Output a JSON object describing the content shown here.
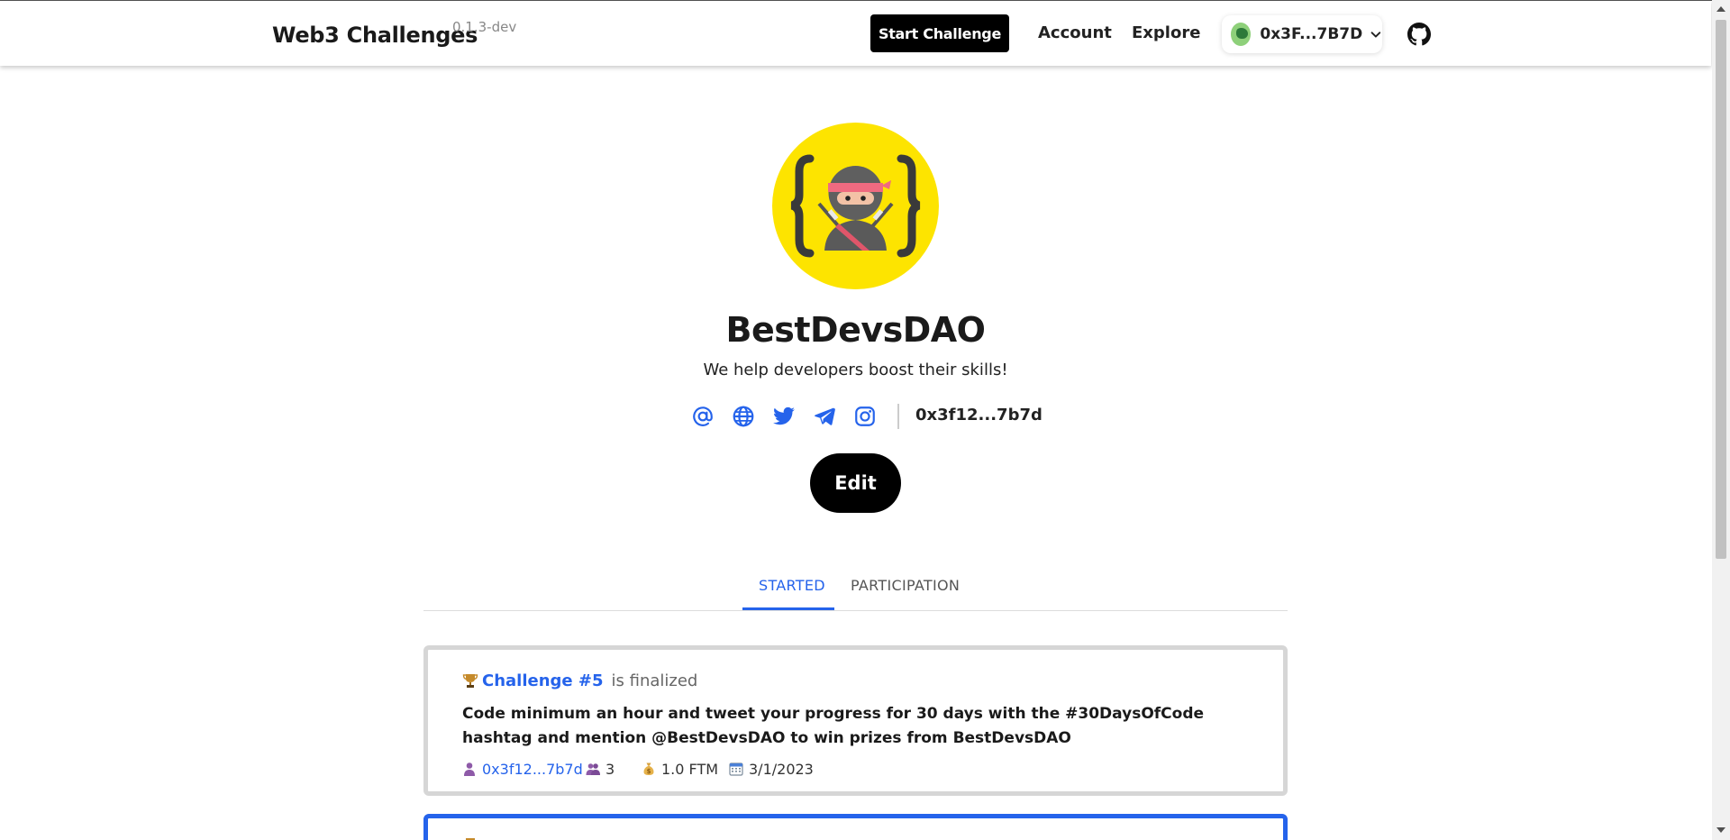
{
  "header": {
    "brand": "Web3 Challenges",
    "version": "0.1.3-dev",
    "start_challenge_label": "Start Challenge",
    "nav": {
      "account": "Account",
      "explore": "Explore"
    },
    "wallet_address": "0x3F...7B7D",
    "icons": {
      "wallet_avatar": "wallet-avatar",
      "chevron": "chevron-down-icon",
      "github": "github-icon"
    }
  },
  "profile": {
    "name": "BestDevsDAO",
    "description": "We help developers boost their skills!",
    "address": "0x3f12...7b7d",
    "socials": [
      "email-icon",
      "website-icon",
      "twitter-icon",
      "telegram-icon",
      "instagram-icon"
    ],
    "edit_label": "Edit",
    "avatar": "ninja-avatar"
  },
  "tabs": [
    {
      "label": "STARTED",
      "active": true
    },
    {
      "label": "PARTICIPATION",
      "active": false
    }
  ],
  "challenges": [
    {
      "title": "Challenge #5",
      "status": "is finalized",
      "description": "Code minimum an hour and tweet your progress for 30 days with the #30DaysOfCode hashtag and mention @BestDevsDAO to win prizes from BestDevsDAO",
      "author": "0x3f12...7b7d",
      "participants": "3",
      "prize": "1.0 FTM",
      "date": "3/1/2023"
    }
  ],
  "colors": {
    "accent": "#2563eb",
    "avatar_bg": "#fde400",
    "card_border": "#d6d6d6",
    "button_bg": "#000000"
  }
}
